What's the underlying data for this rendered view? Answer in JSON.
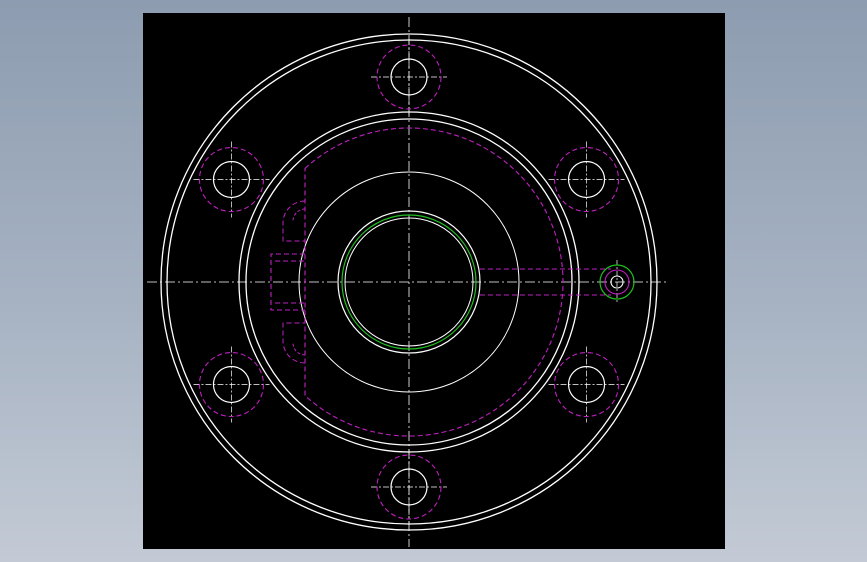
{
  "viewport": {
    "background": "#000000"
  },
  "colors": {
    "outline": "#ffffff",
    "hidden": "#c020c0",
    "bore": "#20c020",
    "center": "#ffffff"
  },
  "drawing": {
    "type": "flange-top-view",
    "bolt_hole_count": 6,
    "bolt_circle_angles_deg": [
      90,
      30,
      -30,
      -90,
      -150,
      150
    ],
    "views": [
      "plan"
    ]
  }
}
